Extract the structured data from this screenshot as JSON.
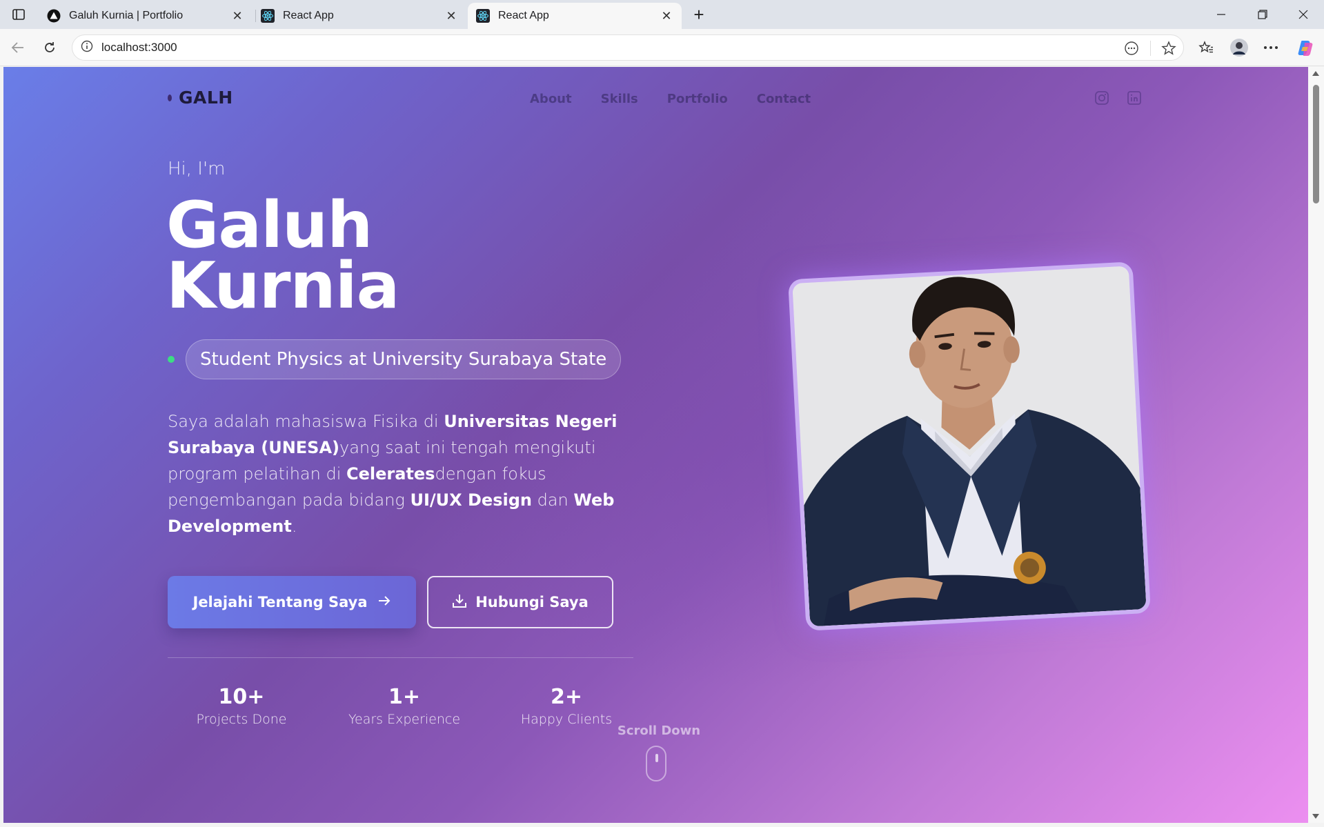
{
  "browser": {
    "tabs": [
      {
        "title": "Galuh Kurnia | Portfolio",
        "icon": "triangle-logo-icon",
        "active": false
      },
      {
        "title": "React App",
        "icon": "react-icon",
        "active": false
      },
      {
        "title": "React App",
        "icon": "react-icon",
        "active": true
      }
    ],
    "url": "localhost:3000"
  },
  "site": {
    "logo": "GALH",
    "nav": [
      "About",
      "Skills",
      "Portfolio",
      "Contact"
    ],
    "social_icons": [
      "instagram-icon",
      "linkedin-icon"
    ]
  },
  "hero": {
    "greeting": "Hi, I'm",
    "name_line1": "Galuh",
    "name_line2": "Kurnia",
    "role": "Student Physics at University Surabaya State",
    "description": {
      "t1": "Saya adalah mahasiswa Fisika di ",
      "b1": "Universitas Negeri Surabaya (UNESA)",
      "t2": "yang saat ini tengah mengikuti program pelatihan di ",
      "b2": "Celerates",
      "t3": "dengan fokus pengembangan pada bidang ",
      "b3": "UI/UX Design",
      "t4": " dan ",
      "b4": "Web Development",
      "t5": "."
    },
    "primary_button": "Jelajahi Tentang Saya",
    "secondary_button": "Hubungi Saya",
    "stats": [
      {
        "value": "10+",
        "label": "Projects Done"
      },
      {
        "value": "1+",
        "label": "Years Experience"
      },
      {
        "value": "2+",
        "label": "Happy Clients"
      }
    ],
    "scroll_label": "Scroll Down"
  },
  "colors": {
    "accent": "#6c7ae6",
    "status_dot": "#3ddc84",
    "gradient_start": "#6a7ee8",
    "gradient_end": "#ec8ff0"
  }
}
